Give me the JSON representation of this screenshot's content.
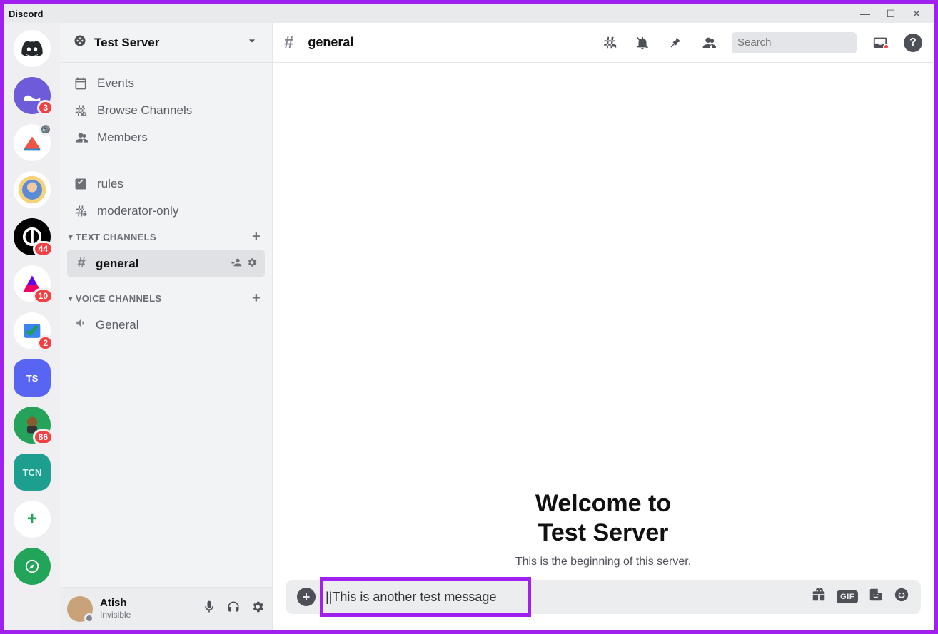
{
  "window": {
    "title": "Discord"
  },
  "servers": [
    {
      "id": "home",
      "type": "home"
    },
    {
      "id": "s1",
      "color": "#6e5bd9",
      "badge": "3",
      "label": ""
    },
    {
      "id": "s2",
      "color": "#ffffff",
      "voice": true,
      "label": ""
    },
    {
      "id": "s3",
      "color": "#ffffff",
      "label": ""
    },
    {
      "id": "s4",
      "color": "#000000",
      "badge": "44",
      "label": ""
    },
    {
      "id": "s5",
      "color": "#ffffff",
      "badge": "10",
      "label": ""
    },
    {
      "id": "s6",
      "color": "#ffffff",
      "badge": "2",
      "label": ""
    },
    {
      "id": "s7",
      "type": "active",
      "label": "TS"
    },
    {
      "id": "s8",
      "color": "#25a35a",
      "badge": "86",
      "label": ""
    },
    {
      "id": "s9",
      "color": "#1e9e8e",
      "label": "TCN"
    }
  ],
  "sidebar": {
    "serverName": "Test Server",
    "top": [
      {
        "icon": "calendar",
        "label": "Events"
      },
      {
        "icon": "browse",
        "label": "Browse Channels"
      },
      {
        "icon": "members",
        "label": "Members"
      }
    ],
    "pinned": [
      {
        "icon": "rules",
        "label": "rules"
      },
      {
        "icon": "hashlock",
        "label": "moderator-only"
      }
    ],
    "textHeader": "TEXT CHANNELS",
    "textChannels": [
      {
        "label": "general",
        "active": true
      }
    ],
    "voiceHeader": "VOICE CHANNELS",
    "voiceChannels": [
      {
        "label": "General"
      }
    ]
  },
  "user": {
    "name": "Atish",
    "status": "Invisible"
  },
  "header": {
    "channel": "general",
    "searchPlaceholder": "Search"
  },
  "welcome": {
    "line1": "Welcome to",
    "line2": "Test Server",
    "subtitle": "This is the beginning of this server."
  },
  "composer": {
    "value": "||This is another test message",
    "gifLabel": "GIF"
  }
}
